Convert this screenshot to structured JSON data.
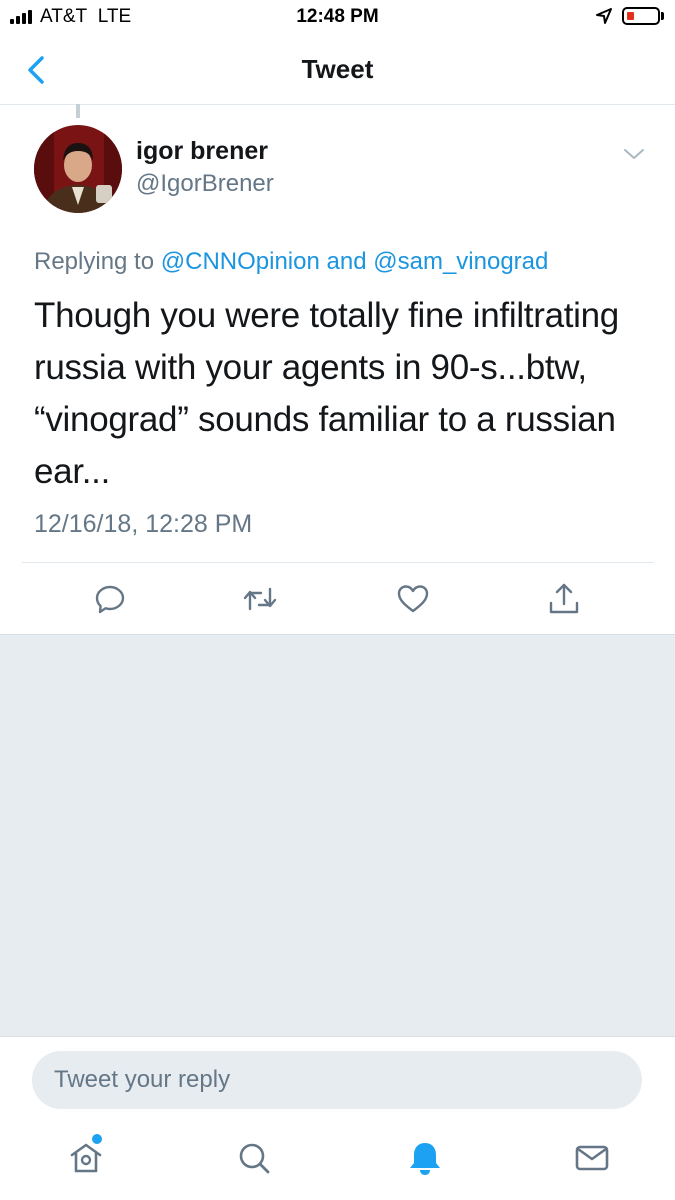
{
  "status_bar": {
    "carrier": "AT&T",
    "network": "LTE",
    "time": "12:48 PM",
    "battery_level_percent": 12
  },
  "nav": {
    "title": "Tweet",
    "back_icon": "chevron-left-icon"
  },
  "tweet": {
    "author": {
      "display_name": "igor brener",
      "handle": "@IgorBrener"
    },
    "replying_prefix": "Replying to",
    "replying_to": [
      "@CNNOpinion",
      "@sam_vinograd"
    ],
    "replying_joiner": "and",
    "text": "Though you were totally fine infiltrating russia with your agents in 90-s...btw, “vinograd” sounds familiar to a russian ear...",
    "timestamp": "12/16/18, 12:28 PM",
    "actions": [
      "reply-icon",
      "retweet-icon",
      "like-icon",
      "share-icon"
    ]
  },
  "reply": {
    "placeholder": "Tweet your reply"
  },
  "tab_bar": {
    "items": [
      "home-icon",
      "search-icon",
      "notifications-icon",
      "messages-icon"
    ],
    "active": "notifications-icon",
    "home_has_new": true
  },
  "colors": {
    "accent": "#1da1f2",
    "link": "#1b95e0",
    "secondary_text": "#657786",
    "background_grey": "#e6ecf0",
    "battery_low": "#e0301e"
  }
}
